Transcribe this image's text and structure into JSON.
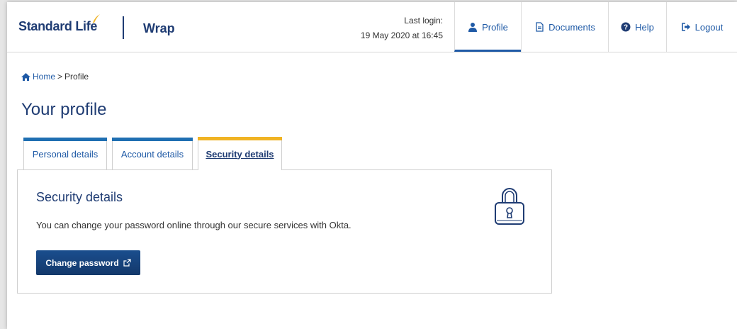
{
  "header": {
    "brand": "Standard Life",
    "product": "Wrap",
    "last_login_label": "Last login:",
    "last_login_value": "19 May 2020 at 16:45"
  },
  "nav": {
    "profile": "Profile",
    "documents": "Documents",
    "help": "Help",
    "logout": "Logout"
  },
  "breadcrumb": {
    "home": "Home",
    "separator": ">",
    "current": "Profile"
  },
  "page_title": "Your profile",
  "tabs": [
    {
      "label": "Personal details",
      "accent": "#1f6fb2"
    },
    {
      "label": "Account details",
      "accent": "#1f6fb2"
    },
    {
      "label": "Security details",
      "accent": "#f0b323"
    }
  ],
  "security": {
    "title": "Security details",
    "description": "You can change your password online through our secure services with Okta.",
    "button_label": "Change password"
  },
  "colors": {
    "brand_navy": "#1f3c73",
    "link_blue": "#1f5aa6",
    "active_tab_accent": "#f0b323",
    "tab_accent": "#1f6fb2"
  }
}
